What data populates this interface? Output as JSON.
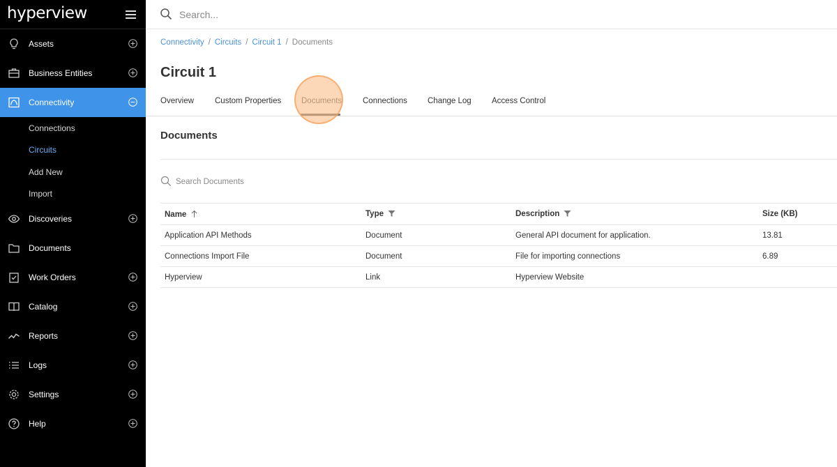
{
  "app": {
    "logo": "hyperview"
  },
  "search": {
    "placeholder": "Search..."
  },
  "sidebar": {
    "items": [
      {
        "label": "Assets"
      },
      {
        "label": "Business Entities"
      },
      {
        "label": "Connectivity"
      },
      {
        "label": "Discoveries"
      },
      {
        "label": "Documents"
      },
      {
        "label": "Work Orders"
      },
      {
        "label": "Catalog"
      },
      {
        "label": "Reports"
      },
      {
        "label": "Logs"
      },
      {
        "label": "Settings"
      },
      {
        "label": "Help"
      }
    ],
    "sub_items": [
      {
        "label": "Connections"
      },
      {
        "label": "Circuits"
      },
      {
        "label": "Add New"
      },
      {
        "label": "Import"
      }
    ],
    "accent_color": "#3f93e8"
  },
  "breadcrumb": [
    "Connectivity",
    "Circuits",
    "Circuit 1",
    "Documents"
  ],
  "page": {
    "title": "Circuit 1"
  },
  "tabs": [
    {
      "label": "Overview"
    },
    {
      "label": "Custom Properties"
    },
    {
      "label": "Documents"
    },
    {
      "label": "Connections"
    },
    {
      "label": "Change Log"
    },
    {
      "label": "Access Control"
    }
  ],
  "documents": {
    "title": "Documents",
    "search_placeholder": "Search Documents",
    "columns": [
      "Name",
      "Type",
      "Description",
      "Size (KB)"
    ],
    "rows": [
      {
        "name": "Application API Methods",
        "type": "Document",
        "description": "General API document for application.",
        "size": "13.81"
      },
      {
        "name": "Connections Import File",
        "type": "Document",
        "description": "File for importing connections",
        "size": "6.89"
      },
      {
        "name": "Hyperview",
        "type": "Link",
        "description": "Hyperview Website",
        "size": ""
      }
    ]
  }
}
